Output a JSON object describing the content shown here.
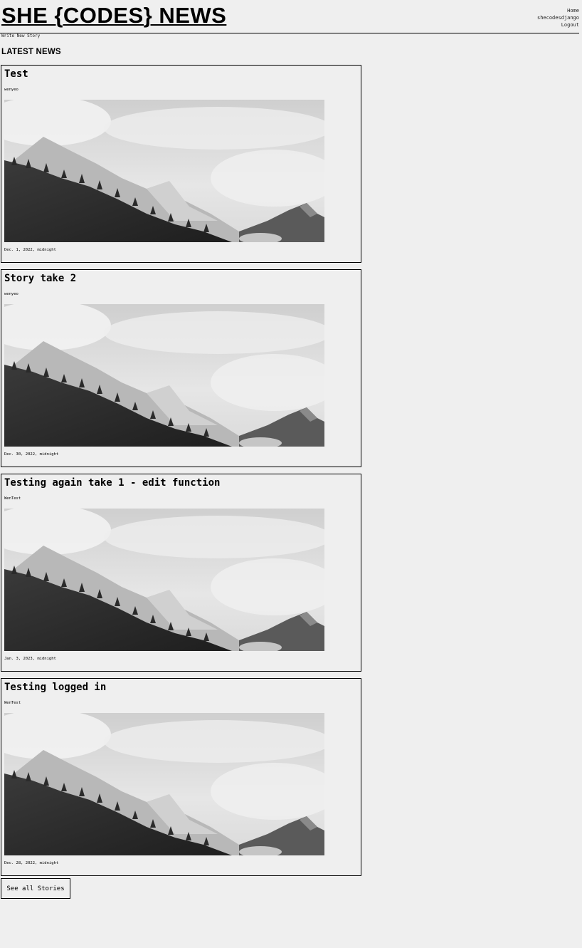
{
  "site": {
    "title": "SHE {CODES} NEWS"
  },
  "nav": {
    "items": [
      "Home",
      "shecodesdjango",
      "Logout"
    ]
  },
  "write_link": "Write New Story",
  "section_title": "LATEST NEWS",
  "stories": [
    {
      "title": "Test",
      "author": "wenyeo",
      "date": "Dec. 1, 2022, midnight",
      "image": "mountain-forest-photo"
    },
    {
      "title": "Story take 2",
      "author": "wenyeo",
      "date": "Dec. 30, 2022, midnight",
      "image": "mountain-forest-photo"
    },
    {
      "title": "Testing again take 1 - edit function",
      "author": "WenTest",
      "date": "Jan. 3, 2023, midnight",
      "image": "mountain-forest-photo"
    },
    {
      "title": "Testing logged in",
      "author": "WenTest",
      "date": "Dec. 28, 2022, midnight",
      "image": "mountain-forest-photo"
    }
  ],
  "see_all_label": "See all Stories"
}
